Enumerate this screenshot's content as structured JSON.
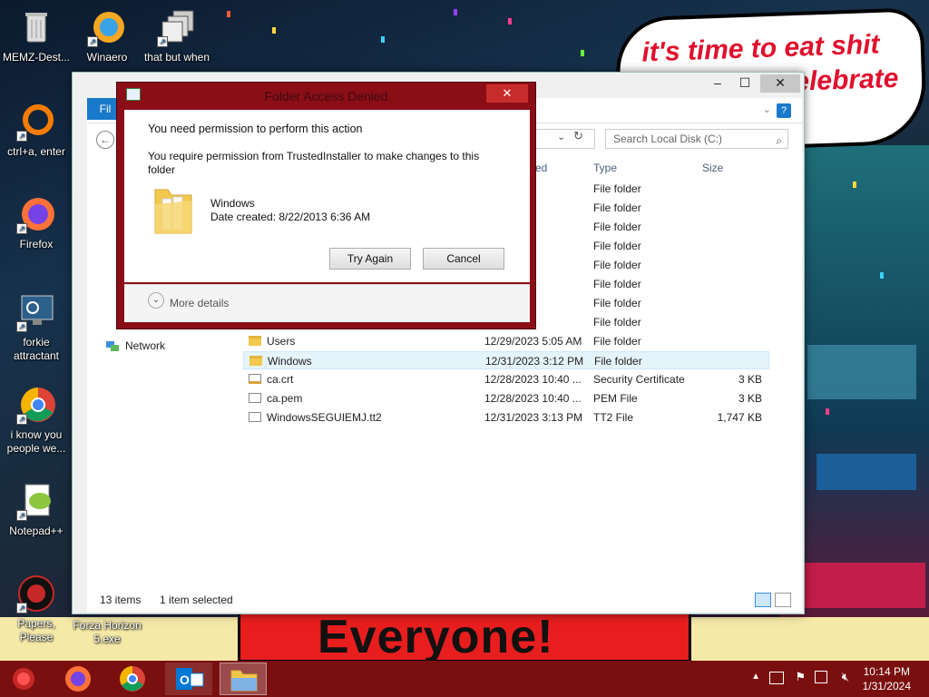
{
  "desktop": {
    "icons": [
      {
        "label": "MEMZ-Dest...",
        "icon": "recycle-bin"
      },
      {
        "label": "Winaero",
        "icon": "winaero-logo"
      },
      {
        "label": "that but when",
        "icon": "stack-windows"
      },
      {
        "label": "ctrl+a, enter",
        "icon": "orange-ring"
      },
      {
        "label": "Firefox",
        "icon": "firefox-logo"
      },
      {
        "label": "forkie attractant",
        "icon": "monitor-gear"
      },
      {
        "label": "i know you people we...",
        "icon": "chrome-logo"
      },
      {
        "label": "Notepad++",
        "icon": "notepad-plus-plus-logo"
      },
      {
        "label": "Papers, Please",
        "icon": "papers-please-logo"
      },
      {
        "label": "Forza Horizon 5.exe",
        "icon": "forza-logo"
      }
    ],
    "wallpaper": {
      "bubble_text_line1": "it's time to eat shit",
      "bubble_text_line2": "celebrate",
      "poster_text": "Everyone!"
    }
  },
  "explorer": {
    "file_tab": "Fil",
    "search_placeholder": "Search Local Disk (C:)",
    "columns": {
      "modified": "fied",
      "type": "Type",
      "size": "Size"
    },
    "nav": [
      {
        "label": "Network",
        "icon": "network-icon"
      }
    ],
    "rows": [
      {
        "name": "",
        "date": "3:32 PM",
        "type": "File folder",
        "size": "",
        "kind": "folder"
      },
      {
        "name": "",
        "date": "1:25 PM",
        "type": "File folder",
        "size": "",
        "kind": "folder"
      },
      {
        "name": "",
        "date": "3:22 AM",
        "type": "File folder",
        "size": "",
        "kind": "folder"
      },
      {
        "name": "",
        "date": "8:53 PM",
        "type": "File folder",
        "size": "",
        "kind": "folder"
      },
      {
        "name": "",
        "date": "3:27 PM",
        "type": "File folder",
        "size": "",
        "kind": "folder"
      },
      {
        "name": "",
        "date": "3:33 PM",
        "type": "File folder",
        "size": "",
        "kind": "folder"
      },
      {
        "name": "",
        "date": "5:36 AM",
        "type": "File folder",
        "size": "",
        "kind": "folder"
      },
      {
        "name": "",
        "date": "11:50 ...",
        "type": "File folder",
        "size": "",
        "kind": "folder"
      },
      {
        "name": "Users",
        "date": "12/29/2023 5:05 AM",
        "type": "File folder",
        "size": "",
        "kind": "folder"
      },
      {
        "name": "Windows",
        "date": "12/31/2023 3:12 PM",
        "type": "File folder",
        "size": "",
        "kind": "folder",
        "selected": true
      },
      {
        "name": "ca.crt",
        "date": "12/28/2023 10:40 ...",
        "type": "Security Certificate",
        "size": "3 KB",
        "kind": "cert"
      },
      {
        "name": "ca.pem",
        "date": "12/28/2023 10:40 ...",
        "type": "PEM File",
        "size": "3 KB",
        "kind": "doc"
      },
      {
        "name": "WindowsSEGUIEMJ.tt2",
        "date": "12/31/2023 3:13 PM",
        "type": "TT2 File",
        "size": "1,747 KB",
        "kind": "doc"
      }
    ],
    "status": {
      "count": "13 items",
      "selected": "1 item selected"
    }
  },
  "dialog": {
    "title": "Folder Access Denied",
    "heading": "You need permission to perform this action",
    "message": "You require permission from TrustedInstaller to make changes to this folder",
    "item_name": "Windows",
    "item_date": "Date created: 8/22/2013 6:36 AM",
    "try_again": "Try Again",
    "cancel": "Cancel",
    "more_details": "More details"
  },
  "taskbar": {
    "apps": [
      "start-orb",
      "firefox",
      "chrome",
      "outlook",
      "file-explorer"
    ],
    "time": "10:14 PM",
    "date": "1/31/2024"
  },
  "colors": {
    "taskbar": "#7a0f0f",
    "dialog_frame": "#8b0e17",
    "accent": "#1979ca"
  }
}
